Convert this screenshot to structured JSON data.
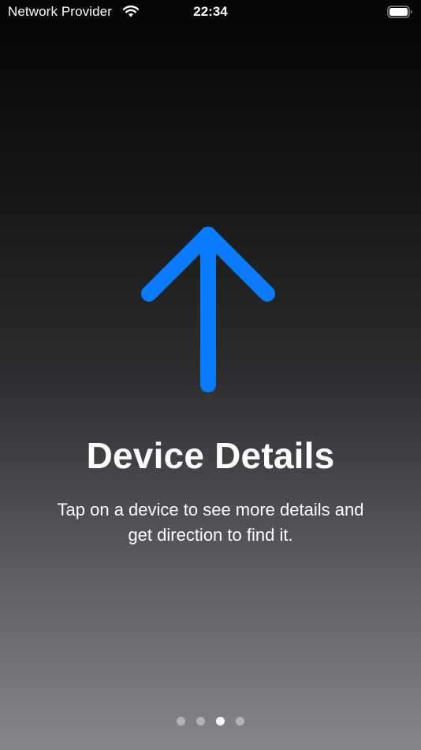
{
  "status_bar": {
    "carrier": "Network Provider",
    "time": "22:34",
    "wifi_icon": "wifi-icon",
    "battery_icon": "battery-icon"
  },
  "hero": {
    "icon": "arrow-up-icon",
    "icon_color": "#0a7aff"
  },
  "content": {
    "title": "Device Details",
    "subtitle": "Tap on a device to see more details and get direction to find it."
  },
  "page_control": {
    "total_pages": 4,
    "current_page": 3
  }
}
